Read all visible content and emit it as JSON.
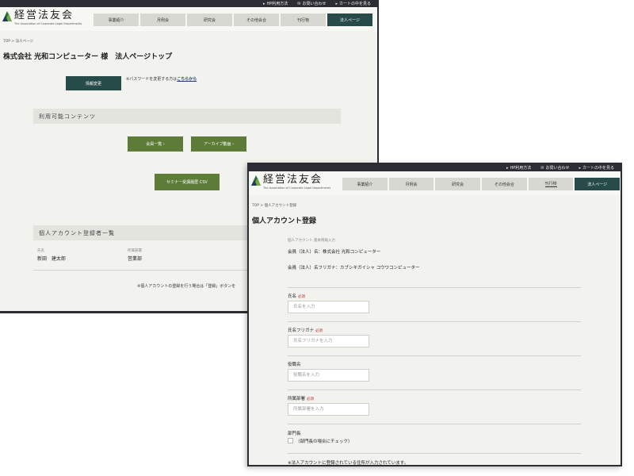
{
  "top_links": [
    {
      "icon": "▸",
      "label": "HP利用方法"
    },
    {
      "icon": "✉",
      "label": "お問い合わせ"
    },
    {
      "icon": "▸",
      "label": "カートの中を見る"
    }
  ],
  "logo": {
    "jp": "経営法友会",
    "en": "The Association of Corporate Legal Departments"
  },
  "nav": [
    "事業紹介",
    "月例会",
    "研究会",
    "その他会合",
    "刊行物",
    "法人ページ"
  ],
  "window1": {
    "breadcrumb": "TOP > 法人ページ",
    "title": "株式会社 光和コンピューター 様　法人ページトップ",
    "edit_button": "情報変更",
    "password_note": "※パスワードを変更する方は",
    "password_link": "こちらから",
    "contents_heading": "利用可能コンテンツ",
    "btn_members": "会員一覧 ›",
    "btn_archive": "アーカイブ動画 ›",
    "btn_csv": "セミナー受講履歴 CSV",
    "accounts_heading": "個人アカウント登録者一覧",
    "col_name": "氏名",
    "col_dept": "所属部署",
    "row_name": "新田　建太郎",
    "row_dept": "営業部",
    "footnote": "※個人アカウントの登録を行う場合は「登録」ボタンを"
  },
  "window2": {
    "breadcrumb": "TOP > 個人アカウント登録",
    "title": "個人アカウント登録",
    "form_caption": "個人アカウント 基本情報入力",
    "member_name": "会員（法人）名：株式会社 光和コンピューター",
    "member_kana": "会員（法人）名フリガナ：カブシキガイシャ コウワコンピューター",
    "required": "必須",
    "fields": [
      {
        "label": "氏名",
        "placeholder": "氏名を入力",
        "required": true
      },
      {
        "label": "氏名フリガナ",
        "placeholder": "氏名フリガナを入力",
        "required": true
      },
      {
        "label": "役職名",
        "placeholder": "役職名を入力",
        "required": false
      },
      {
        "label": "所属部署",
        "placeholder": "所属部署を入力",
        "required": true
      }
    ],
    "dept_head_label": "部門長",
    "dept_head_check": "（部門長の場合にチェック）",
    "bottom_note": "※法人アカウントに登録されている住所が入力されています。"
  }
}
